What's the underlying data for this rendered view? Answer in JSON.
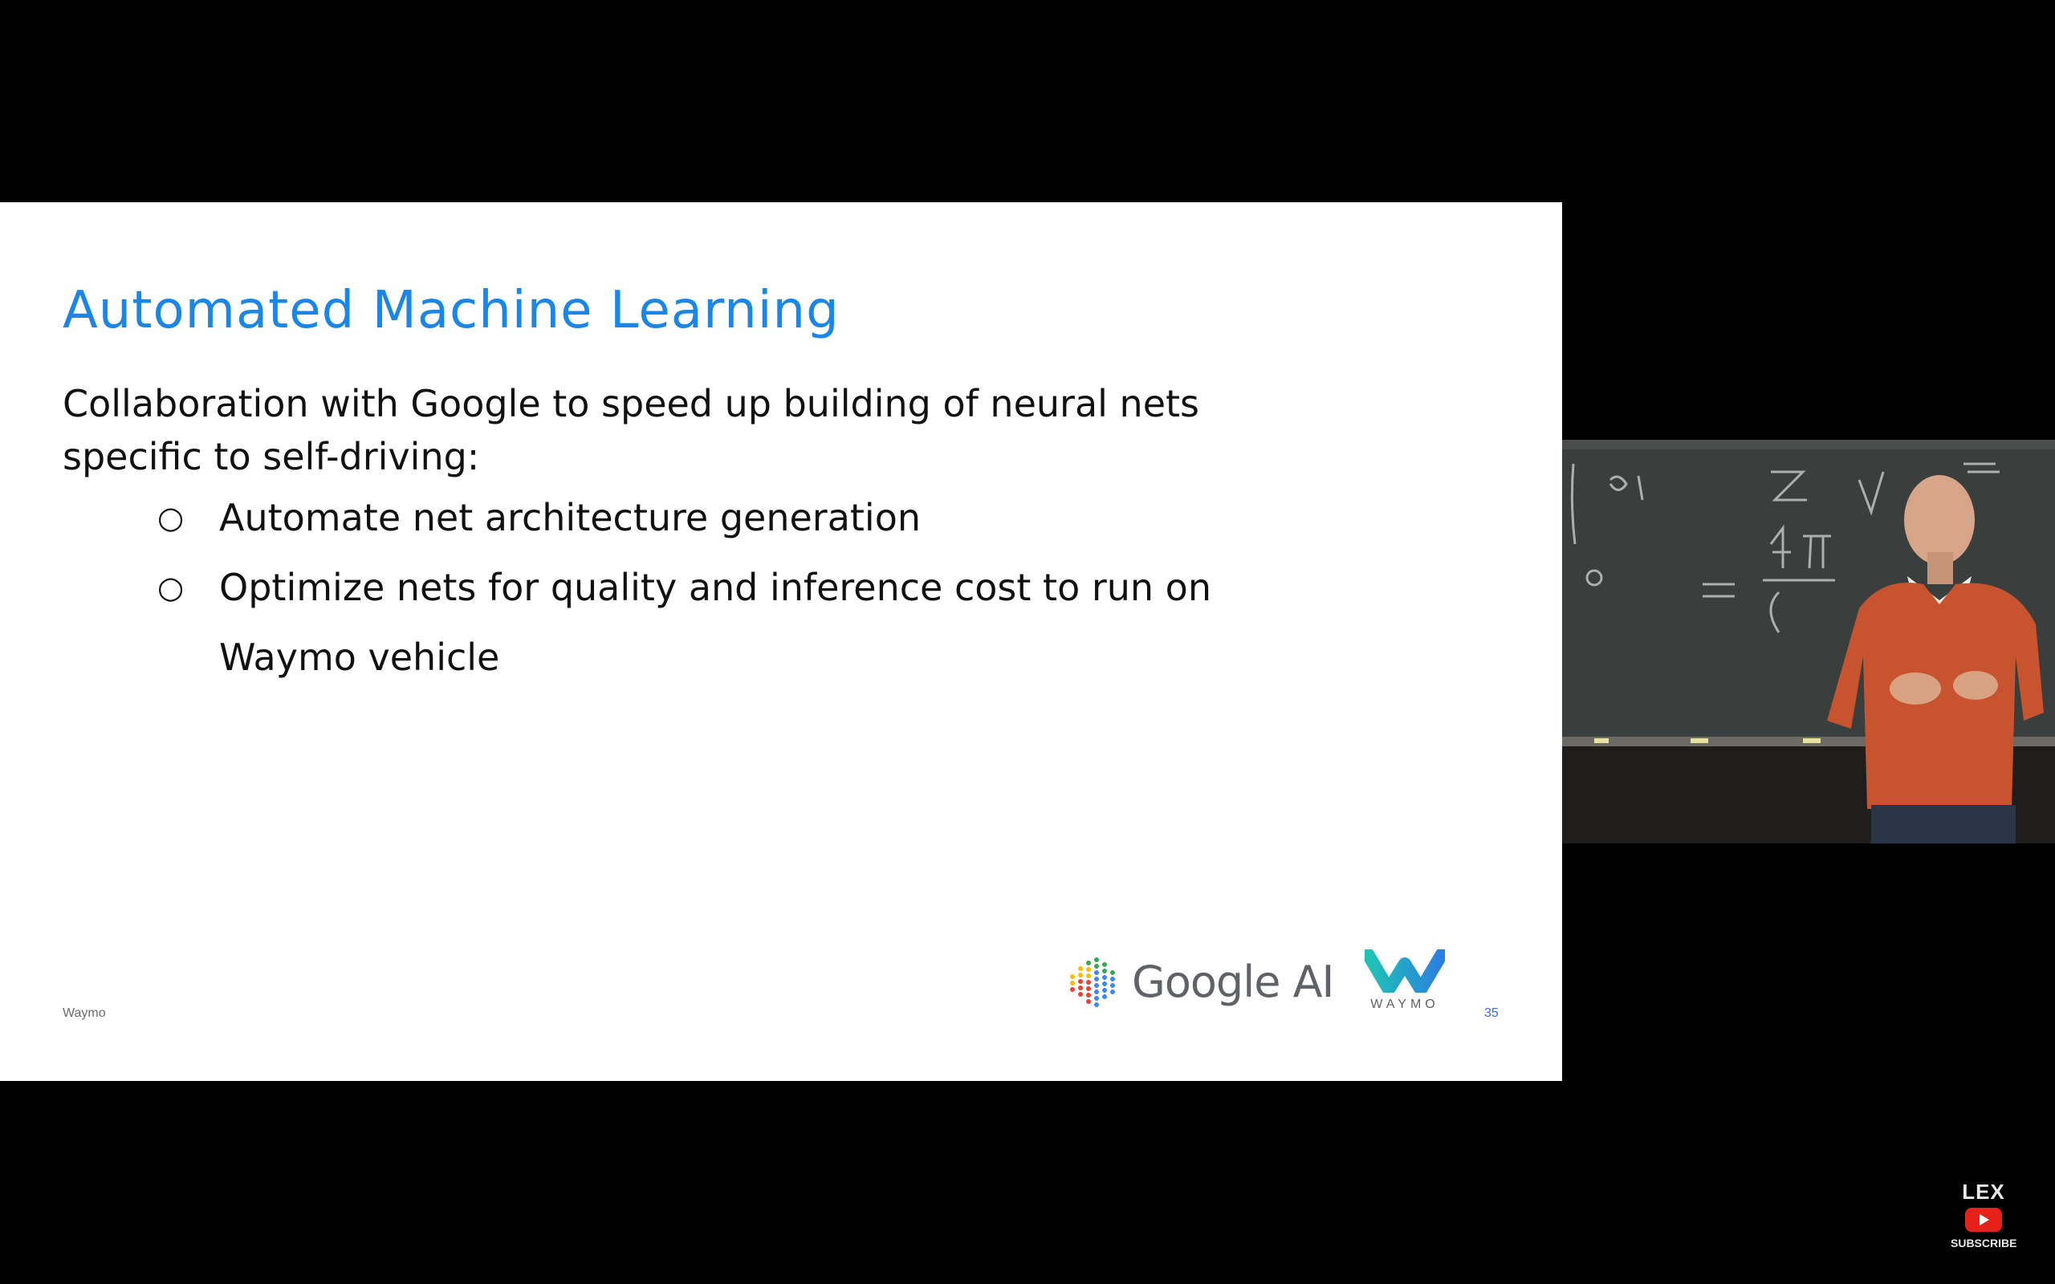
{
  "slide": {
    "title": "Automated Machine Learning",
    "intro_line1": "Collaboration with Google to speed up building of neural nets",
    "intro_line2": "specific to self-driving:",
    "bullet_mark": "○",
    "bullets": [
      {
        "line1": "Automate net architecture generation"
      },
      {
        "line1": "Optimize nets for quality and inference cost to run on",
        "line2": "Waymo vehicle"
      }
    ],
    "footer_left": "Waymo",
    "page_number": "35",
    "logos": {
      "google_ai": "Google AI",
      "waymo": "WAYMO"
    },
    "colors": {
      "title": "#1a86e8",
      "waymo_teal": "#20c4b5",
      "waymo_blue": "#2a7fe0"
    }
  },
  "speaker_video": {
    "description_icon": "lecturer-video-icon"
  },
  "channel_watermark": {
    "name": "LEX",
    "subscribe_label": "SUBSCRIBE"
  }
}
